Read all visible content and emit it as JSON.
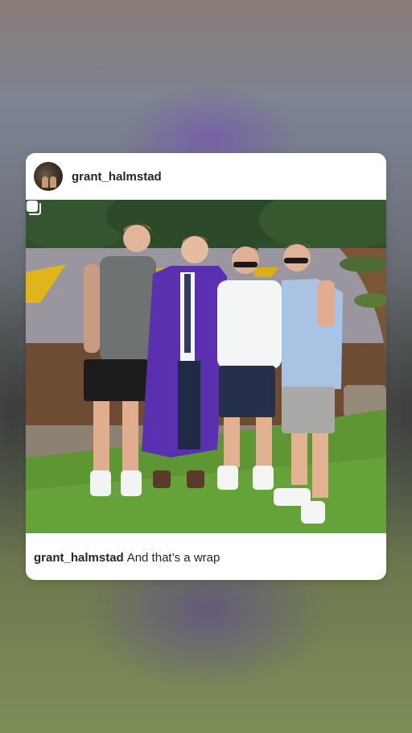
{
  "post": {
    "username": "grant_halmstad",
    "caption_user": "grant_halmstad",
    "caption_text": "And that’s a wrap"
  },
  "icons": {
    "avatar": "profile-avatar",
    "multi_image": "carousel-icon"
  }
}
